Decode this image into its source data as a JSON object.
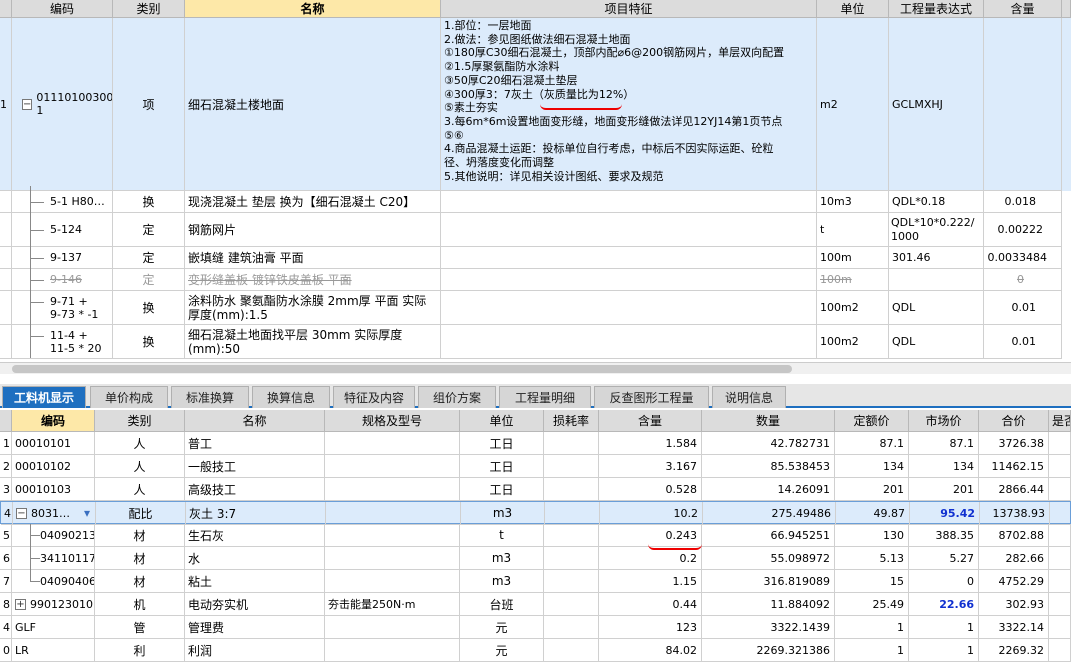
{
  "top_table": {
    "headers": [
      "编码",
      "类别",
      "名称",
      "项目特征",
      "单位",
      "工程量表达式",
      "含量"
    ],
    "main": {
      "row_index": "1",
      "code": "01110100300\n1",
      "type": "项",
      "name": "细石混凝土楼地面",
      "features": [
        "1.部位：一层地面",
        "2.做法：参见图纸做法细石混凝土地面",
        "①180厚C30细石混凝土，顶部内配⌀6@200钢筋网片，单层双向配置",
        "②1.5厚聚氨酯防水涂料",
        "③50厚C20细石混凝土垫层",
        "④300厚3：7灰土（灰质量比为12%）",
        "⑤素土夯实",
        "3.每6m*6m设置地面变形缝，地面变形缝做法详见12YJ14第1页节点",
        "⑤⑥",
        "4.商品混凝土运距：投标单位自行考虑，中标后不因实际运距、砼粒",
        "径、坍落度变化而调整",
        "5.其他说明：详见相关设计图纸、要求及规范"
      ],
      "unit": "m2",
      "expr": "GCLMXHJ",
      "amount": ""
    },
    "rows": [
      {
        "code": "5-1 H80…",
        "type": "换",
        "name": "现浇混凝土 垫层  换为【细石混凝土 C20】",
        "unit": "10m3",
        "expr": "QDL*0.18",
        "amount": "0.018"
      },
      {
        "code": "5-124",
        "type": "定",
        "name": "钢筋网片",
        "unit": "t",
        "expr": "QDL*10*0.222/1000",
        "amount": "0.00222"
      },
      {
        "code": "9-137",
        "type": "定",
        "name": "嵌填缝 建筑油膏 平面",
        "unit": "100m",
        "expr": "301.46",
        "amount": "0.0033484"
      },
      {
        "code": "9-146",
        "type": "定",
        "name": "变形缝盖板 镀锌铁皮盖板 平面",
        "unit": "100m",
        "expr": "",
        "amount": "0"
      },
      {
        "code": "9-71 +\n9-73 * -1",
        "type": "换",
        "name": "涂料防水 聚氨酯防水涂膜 2mm厚 平面  实际厚度(mm):1.5",
        "unit": "100m2",
        "expr": "QDL",
        "amount": "0.01"
      },
      {
        "code": "11-4 +\n11-5 * 20",
        "type": "换",
        "name": "细石混凝土地面找平层 30mm  实际厚度(mm):50",
        "unit": "100m2",
        "expr": "QDL",
        "amount": "0.01"
      }
    ]
  },
  "tabs": [
    "工料机显示",
    "单价构成",
    "标准换算",
    "换算信息",
    "特征及内容",
    "组价方案",
    "工程量明细",
    "反查图形工程量",
    "说明信息"
  ],
  "bottom_table": {
    "headers": [
      "编码",
      "类别",
      "名称",
      "规格及型号",
      "单位",
      "损耗率",
      "含量",
      "数量",
      "定额价",
      "市场价",
      "合价",
      "是否"
    ],
    "rows": [
      {
        "idx": "1",
        "code": "00010101",
        "type": "人",
        "name": "普工",
        "spec": "",
        "unit": "工日",
        "loss": "",
        "amount": "1.584",
        "qty": "42.782731",
        "quota": "87.1",
        "market": "87.1",
        "total": "3726.38"
      },
      {
        "idx": "2",
        "code": "00010102",
        "type": "人",
        "name": "一般技工",
        "spec": "",
        "unit": "工日",
        "loss": "",
        "amount": "3.167",
        "qty": "85.538453",
        "quota": "134",
        "market": "134",
        "total": "11462.15"
      },
      {
        "idx": "3",
        "code": "00010103",
        "type": "人",
        "name": "高级技工",
        "spec": "",
        "unit": "工日",
        "loss": "",
        "amount": "0.528",
        "qty": "14.26091",
        "quota": "201",
        "market": "201",
        "total": "2866.44"
      },
      {
        "idx": "4",
        "code": "8031…",
        "type": "配比",
        "name": "灰土 3:7",
        "spec": "",
        "unit": "m3",
        "loss": "",
        "amount": "10.2",
        "qty": "275.49486",
        "quota": "49.87",
        "market": "95.42",
        "total": "13738.93"
      },
      {
        "idx": "5",
        "code": "04090213",
        "type": "材",
        "name": "生石灰",
        "spec": "",
        "unit": "t",
        "loss": "",
        "amount": "0.243",
        "qty": "66.945251",
        "quota": "130",
        "market": "388.35",
        "total": "8702.88"
      },
      {
        "idx": "6",
        "code": "34110117",
        "type": "材",
        "name": "水",
        "spec": "",
        "unit": "m3",
        "loss": "",
        "amount": "0.2",
        "qty": "55.098972",
        "quota": "5.13",
        "market": "5.27",
        "total": "282.66"
      },
      {
        "idx": "7",
        "code": "04090406",
        "type": "材",
        "name": "粘土",
        "spec": "",
        "unit": "m3",
        "loss": "",
        "amount": "1.15",
        "qty": "316.819089",
        "quota": "15",
        "market": "0",
        "total": "4752.29"
      },
      {
        "idx": "8",
        "code": "990123010",
        "type": "机",
        "name": "电动夯实机",
        "spec": "夯击能量250N·m",
        "unit": "台班",
        "loss": "",
        "amount": "0.44",
        "qty": "11.884092",
        "quota": "25.49",
        "market": "22.66",
        "total": "302.93"
      },
      {
        "idx": "4",
        "code": "GLF",
        "type": "管",
        "name": "管理费",
        "spec": "",
        "unit": "元",
        "loss": "",
        "amount": "123",
        "qty": "3322.1439",
        "quota": "1",
        "market": "1",
        "total": "3322.14"
      },
      {
        "idx": "0",
        "code": "LR",
        "type": "利",
        "name": "利润",
        "spec": "",
        "unit": "元",
        "loss": "",
        "amount": "84.02",
        "qty": "2269.321386",
        "quota": "1",
        "market": "1",
        "total": "2269.32"
      }
    ]
  },
  "colors": {
    "selected_row": "#dcebfb",
    "active_tab": "#1e6fc0",
    "header": "#dcdcdc",
    "highlight_header": "#fde8a8",
    "annotation": "#e00000"
  }
}
